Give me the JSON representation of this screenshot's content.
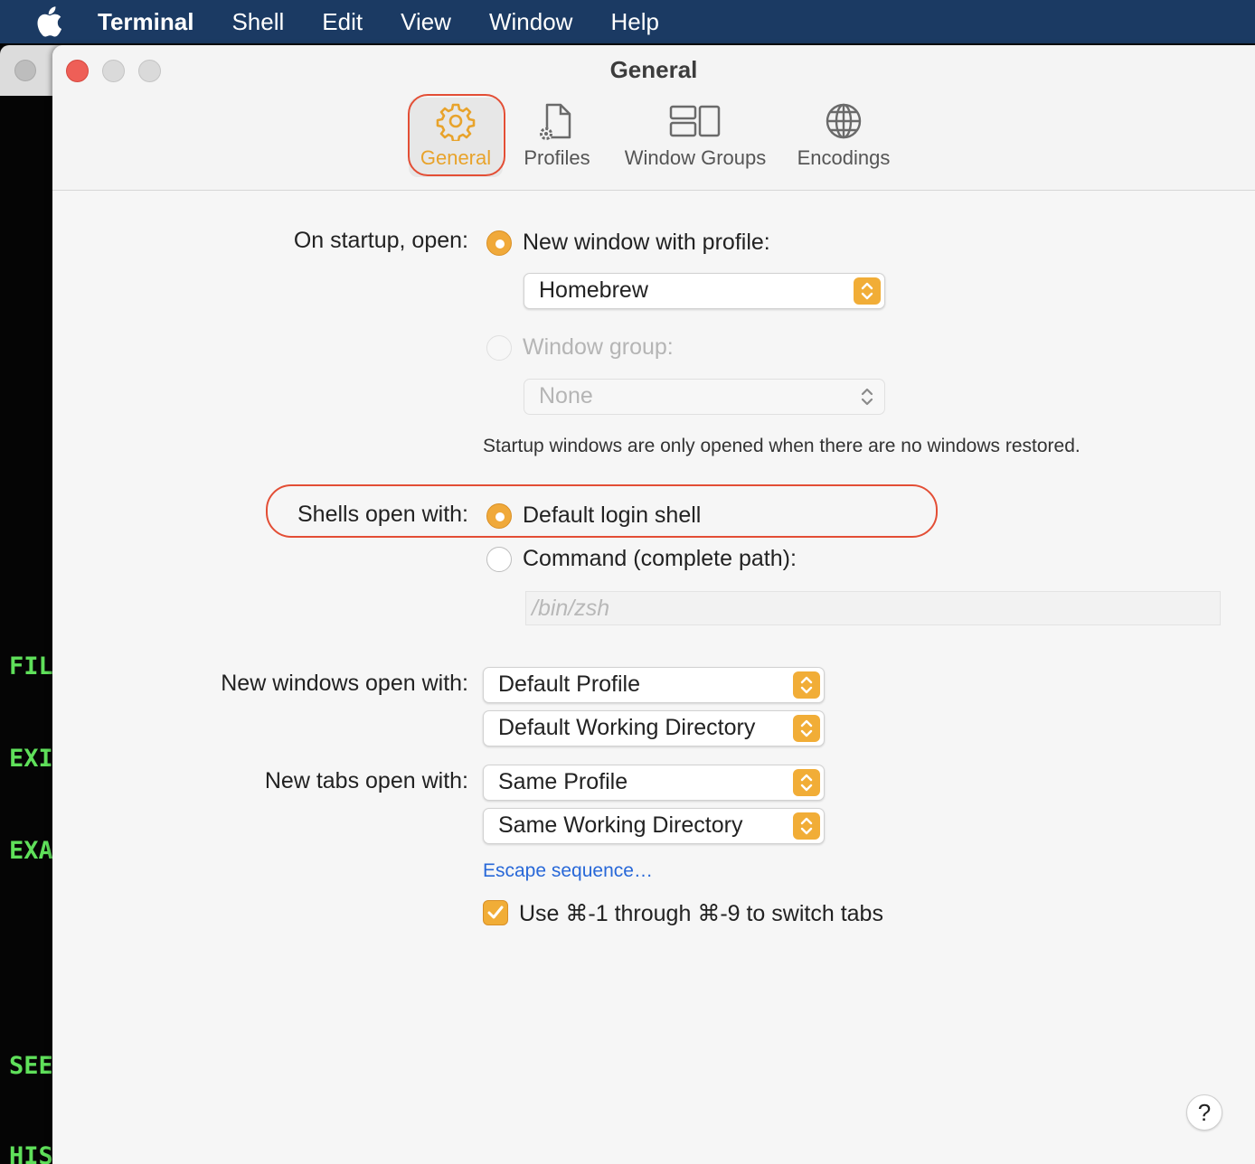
{
  "menubar": {
    "app_name": "Terminal",
    "items": [
      "Shell",
      "Edit",
      "View",
      "Window",
      "Help"
    ]
  },
  "background_terminal": {
    "lines": [
      "FIL",
      "EXI",
      "EXA",
      "SEE",
      "HIS"
    ],
    "text_color": "#5fe05a"
  },
  "window": {
    "title": "General",
    "tabs": [
      {
        "label": "General",
        "icon": "gear-icon",
        "selected": true
      },
      {
        "label": "Profiles",
        "icon": "profiles-icon",
        "selected": false
      },
      {
        "label": "Window Groups",
        "icon": "window-groups-icon",
        "selected": false
      },
      {
        "label": "Encodings",
        "icon": "globe-icon",
        "selected": false
      }
    ]
  },
  "startup": {
    "label": "On startup, open:",
    "new_window_option": "New window with profile:",
    "profile_value": "Homebrew",
    "window_group_option": "Window group:",
    "window_group_value": "None",
    "note": "Startup windows are only opened when there are no windows restored."
  },
  "shells": {
    "label": "Shells open with:",
    "default_option": "Default login shell",
    "command_option": "Command (complete path):",
    "command_placeholder": "/bin/zsh"
  },
  "new_windows": {
    "label": "New windows open with:",
    "profile_value": "Default Profile",
    "directory_value": "Default Working Directory"
  },
  "new_tabs": {
    "label": "New tabs open with:",
    "profile_value": "Same Profile",
    "directory_value": "Same Working Directory"
  },
  "escape_link": "Escape sequence…",
  "switch_tabs_checkbox": {
    "label": "Use ⌘-1 through ⌘-9 to switch tabs",
    "checked": true
  },
  "help_button": "?",
  "colors": {
    "accent": "#f1ad37",
    "highlight": "#e34e35",
    "link": "#2868d8",
    "menubar": "#1b3a63"
  }
}
